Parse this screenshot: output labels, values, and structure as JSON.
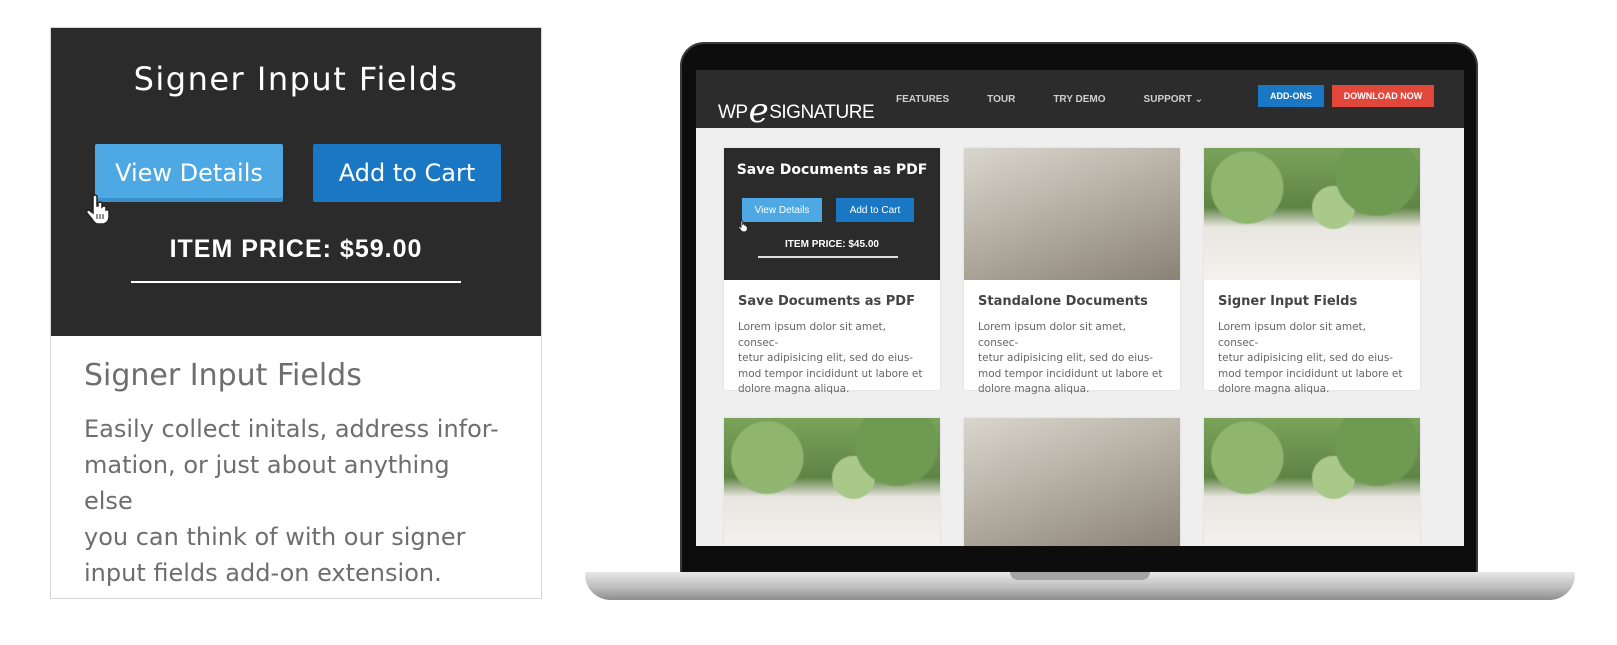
{
  "product_card": {
    "overlay_title": "Signer Input Fields",
    "view_details_label": "View Details",
    "add_to_cart_label": "Add to Cart",
    "price_text": "ITEM PRICE: $59.00",
    "title": "Signer Input Fields",
    "description": "Easily collect initals, address infor-\nmation, or just about anything else\nyou can think of with our signer\ninput fields add-on extension."
  },
  "site": {
    "logo_prefix": "WP",
    "logo_mark": "e",
    "logo_suffix": "SIGNATURE",
    "nav": [
      "FEATURES",
      "TOUR",
      "TRY DEMO",
      "SUPPORT ⌄"
    ],
    "addons_label": "ADD-ONS",
    "download_label": "DOWNLOAD NOW",
    "tiles": [
      {
        "title": "Save Documents as PDF",
        "desc": "Lorem ipsum dolor sit amet, consec-\ntetur adipisicing elit, sed do eius-\nmod tempor incididunt ut labore et\ndolore magna aliqua.",
        "image": "hover-overlay",
        "overlay": {
          "title": "Save Documents as PDF",
          "view_label": "View Details",
          "cart_label": "Add to Cart",
          "price_text": "ITEM PRICE: $45.00"
        }
      },
      {
        "title": "Standalone Documents",
        "desc": "Lorem ipsum dolor sit amet, consec-\ntetur adipisicing elit, sed do eius-\nmod tempor incididunt ut labore et\ndolore magna aliqua.",
        "image": "blueprints-photo"
      },
      {
        "title": "Signer Input Fields",
        "desc": "Lorem ipsum dolor sit amet, consec-\ntetur adipisicing elit, sed do eius-\nmod tempor incididunt ut labore et\ndolore magna aliqua.",
        "image": "coffee-phone-photo"
      }
    ]
  },
  "colors": {
    "dark_panel": "#2b2b2b",
    "light_blue": "#4da8e4",
    "blue": "#1a77c4",
    "red": "#e2473b"
  },
  "icons": [
    "hand-pointer-icon"
  ]
}
